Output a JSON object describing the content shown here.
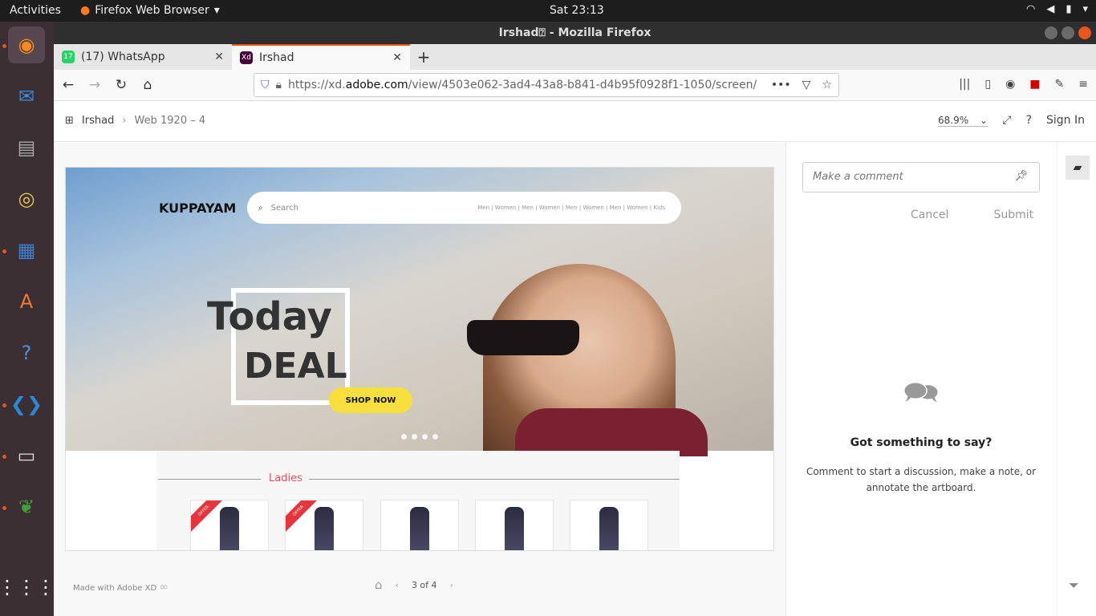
{
  "system": {
    "activities": "Activities",
    "app_menu": "Firefox Web Browser",
    "clock": "Sat 23:13"
  },
  "window": {
    "title": "Irshad⍰ - Mozilla Firefox"
  },
  "tabs": [
    {
      "label": "(17) WhatsApp",
      "favicon": "17"
    },
    {
      "label": "Irshad",
      "favicon": "Xd"
    }
  ],
  "address": {
    "prefix": "https://xd.",
    "domain": "adobe.com",
    "path": "/view/4503e062-3ad4-43a8-b841-d4b95f0928f1-1050/screen/"
  },
  "xd": {
    "breadcrumb_root": "Irshad",
    "breadcrumb_page": "Web 1920 – 4",
    "zoom": "68.9%",
    "sign_in": "Sign In"
  },
  "design": {
    "brand": "KUPPAYAM",
    "search_placeholder": "Search",
    "categories": "Men | Women | Men | Women | Men | Women | Men | Women | Kids",
    "headline_1": "Today",
    "headline_2": "DEAL",
    "cta": "SHOP NOW",
    "section_title": "Ladies",
    "ribbon": "OFFER"
  },
  "footer": {
    "made_with": "Made with Adobe XD",
    "page_indicator": "3 of 4"
  },
  "comments": {
    "placeholder": "Make a comment",
    "cancel": "Cancel",
    "submit": "Submit",
    "empty_title": "Got something to say?",
    "empty_body": "Comment to start a discussion, make a note, or annotate the artboard."
  }
}
